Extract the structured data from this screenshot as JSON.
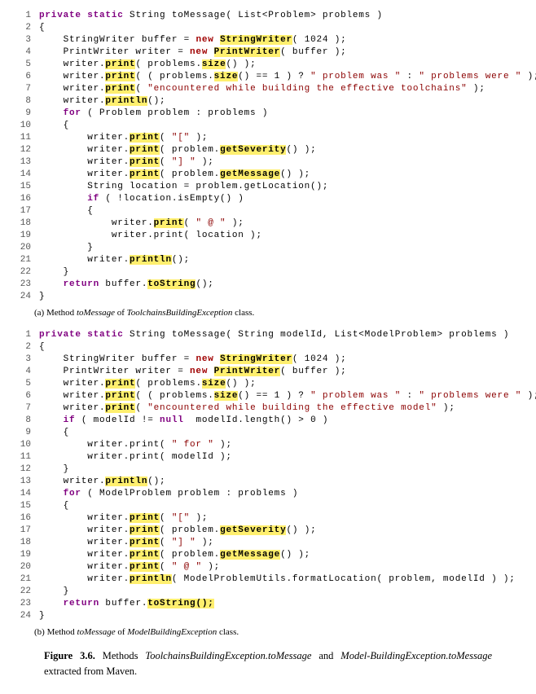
{
  "listingA": {
    "lines": [
      {
        "n": 1,
        "seg": [
          {
            "t": "private",
            "cls": "kw"
          },
          {
            "t": " "
          },
          {
            "t": "static",
            "cls": "kw"
          },
          {
            "t": " String toMessage( List<Problem> problems )"
          }
        ]
      },
      {
        "n": 2,
        "seg": [
          {
            "t": "{"
          }
        ]
      },
      {
        "n": 3,
        "seg": [
          {
            "t": "    StringWriter buffer = "
          },
          {
            "t": "new",
            "cls": "kwr"
          },
          {
            "t": " "
          },
          {
            "t": "StringWriter",
            "cls": "hl"
          },
          {
            "t": "( 1024 );"
          }
        ]
      },
      {
        "n": 4,
        "seg": [
          {
            "t": "    PrintWriter writer = "
          },
          {
            "t": "new",
            "cls": "kwr"
          },
          {
            "t": " "
          },
          {
            "t": "PrintWriter",
            "cls": "hl"
          },
          {
            "t": "( buffer );"
          }
        ]
      },
      {
        "n": 5,
        "seg": [
          {
            "t": "    writer."
          },
          {
            "t": "print",
            "cls": "hl"
          },
          {
            "t": "( problems."
          },
          {
            "t": "size",
            "cls": "hl"
          },
          {
            "t": "() );"
          }
        ]
      },
      {
        "n": 6,
        "seg": [
          {
            "t": "    writer."
          },
          {
            "t": "print",
            "cls": "hl"
          },
          {
            "t": "( ( problems."
          },
          {
            "t": "size",
            "cls": "hl"
          },
          {
            "t": "() == 1 ) ? "
          },
          {
            "t": "\" problem was \"",
            "cls": "str"
          },
          {
            "t": " : "
          },
          {
            "t": "\" problems were \"",
            "cls": "str"
          },
          {
            "t": " );"
          }
        ]
      },
      {
        "n": 7,
        "seg": [
          {
            "t": "    writer."
          },
          {
            "t": "print",
            "cls": "hl"
          },
          {
            "t": "( "
          },
          {
            "t": "\"encountered while building the effective toolchains\"",
            "cls": "str"
          },
          {
            "t": " );"
          }
        ]
      },
      {
        "n": 8,
        "seg": [
          {
            "t": "    writer."
          },
          {
            "t": "println",
            "cls": "hl"
          },
          {
            "t": "();"
          }
        ]
      },
      {
        "n": 9,
        "seg": [
          {
            "t": "    "
          },
          {
            "t": "for",
            "cls": "kw"
          },
          {
            "t": " ( Problem problem : problems )"
          }
        ]
      },
      {
        "n": 10,
        "seg": [
          {
            "t": "    {"
          }
        ]
      },
      {
        "n": 11,
        "seg": [
          {
            "t": "        writer."
          },
          {
            "t": "print",
            "cls": "hl"
          },
          {
            "t": "( "
          },
          {
            "t": "\"[\"",
            "cls": "str"
          },
          {
            "t": " );"
          }
        ]
      },
      {
        "n": 12,
        "seg": [
          {
            "t": "        writer."
          },
          {
            "t": "print",
            "cls": "hl"
          },
          {
            "t": "( problem."
          },
          {
            "t": "getSeverity",
            "cls": "hl"
          },
          {
            "t": "() );"
          }
        ]
      },
      {
        "n": 13,
        "seg": [
          {
            "t": "        writer."
          },
          {
            "t": "print",
            "cls": "hl"
          },
          {
            "t": "( "
          },
          {
            "t": "\"] \"",
            "cls": "str"
          },
          {
            "t": " );"
          }
        ]
      },
      {
        "n": 14,
        "seg": [
          {
            "t": "        writer."
          },
          {
            "t": "print",
            "cls": "hl"
          },
          {
            "t": "( problem."
          },
          {
            "t": "getMessage",
            "cls": "hl"
          },
          {
            "t": "() );"
          }
        ]
      },
      {
        "n": 15,
        "seg": [
          {
            "t": "        String location = problem.getLocation();"
          }
        ]
      },
      {
        "n": 16,
        "seg": [
          {
            "t": "        "
          },
          {
            "t": "if",
            "cls": "kw"
          },
          {
            "t": " ( !location.isEmpty() )"
          }
        ]
      },
      {
        "n": 17,
        "seg": [
          {
            "t": "        {"
          }
        ]
      },
      {
        "n": 18,
        "seg": [
          {
            "t": "            writer."
          },
          {
            "t": "print",
            "cls": "hl"
          },
          {
            "t": "( "
          },
          {
            "t": "\" @ \"",
            "cls": "str"
          },
          {
            "t": " );"
          }
        ]
      },
      {
        "n": 19,
        "seg": [
          {
            "t": "            writer.print( location );"
          }
        ]
      },
      {
        "n": 20,
        "seg": [
          {
            "t": "        }"
          }
        ]
      },
      {
        "n": 21,
        "seg": [
          {
            "t": "        writer."
          },
          {
            "t": "println",
            "cls": "hl"
          },
          {
            "t": "();"
          }
        ]
      },
      {
        "n": 22,
        "seg": [
          {
            "t": "    }"
          }
        ]
      },
      {
        "n": 23,
        "seg": [
          {
            "t": "    "
          },
          {
            "t": "return",
            "cls": "kw"
          },
          {
            "t": " buffer."
          },
          {
            "t": "toString",
            "cls": "hl"
          },
          {
            "t": "();"
          }
        ]
      },
      {
        "n": 24,
        "seg": [
          {
            "t": "}"
          }
        ]
      }
    ]
  },
  "captionA_prefix": "(a) Method ",
  "captionA_em1": "toMessage",
  "captionA_mid": " of ",
  "captionA_em2": "ToolchainsBuildingException",
  "captionA_suffix": " class.",
  "listingB": {
    "lines": [
      {
        "n": 1,
        "seg": [
          {
            "t": "private",
            "cls": "kw"
          },
          {
            "t": " "
          },
          {
            "t": "static",
            "cls": "kw"
          },
          {
            "t": " String toMessage( String modelId, List<ModelProblem> problems )"
          }
        ]
      },
      {
        "n": 2,
        "seg": [
          {
            "t": "{"
          }
        ]
      },
      {
        "n": 3,
        "seg": [
          {
            "t": "    StringWriter buffer = "
          },
          {
            "t": "new",
            "cls": "kwr"
          },
          {
            "t": " "
          },
          {
            "t": "StringWriter",
            "cls": "hl"
          },
          {
            "t": "( 1024 );"
          }
        ]
      },
      {
        "n": 4,
        "seg": [
          {
            "t": "    PrintWriter writer = "
          },
          {
            "t": "new",
            "cls": "kwr"
          },
          {
            "t": " "
          },
          {
            "t": "PrintWriter",
            "cls": "hl"
          },
          {
            "t": "( buffer );"
          }
        ]
      },
      {
        "n": 5,
        "seg": [
          {
            "t": "    writer."
          },
          {
            "t": "print",
            "cls": "hl"
          },
          {
            "t": "( problems."
          },
          {
            "t": "size",
            "cls": "hl"
          },
          {
            "t": "() );"
          }
        ]
      },
      {
        "n": 6,
        "seg": [
          {
            "t": "    writer."
          },
          {
            "t": "print",
            "cls": "hl"
          },
          {
            "t": "( ( problems."
          },
          {
            "t": "size",
            "cls": "hl"
          },
          {
            "t": "() == 1 ) ? "
          },
          {
            "t": "\" problem was \"",
            "cls": "str"
          },
          {
            "t": " : "
          },
          {
            "t": "\" problems were \"",
            "cls": "str"
          },
          {
            "t": " );"
          }
        ]
      },
      {
        "n": 7,
        "seg": [
          {
            "t": "    writer."
          },
          {
            "t": "print",
            "cls": "hl"
          },
          {
            "t": "( "
          },
          {
            "t": "\"encountered while building the effective model\"",
            "cls": "str"
          },
          {
            "t": " );"
          }
        ]
      },
      {
        "n": 8,
        "seg": [
          {
            "t": "    "
          },
          {
            "t": "if",
            "cls": "kw"
          },
          {
            "t": " ( modelId != "
          },
          {
            "t": "null",
            "cls": "kw"
          },
          {
            "t": "  modelId.length() > 0 )"
          }
        ]
      },
      {
        "n": 9,
        "seg": [
          {
            "t": "    {"
          }
        ]
      },
      {
        "n": 10,
        "seg": [
          {
            "t": "        writer.print( "
          },
          {
            "t": "\" for \"",
            "cls": "str"
          },
          {
            "t": " );"
          }
        ]
      },
      {
        "n": 11,
        "seg": [
          {
            "t": "        writer.print( modelId );"
          }
        ]
      },
      {
        "n": 12,
        "seg": [
          {
            "t": "    }"
          }
        ]
      },
      {
        "n": 13,
        "seg": [
          {
            "t": "    writer."
          },
          {
            "t": "println",
            "cls": "hl"
          },
          {
            "t": "();"
          }
        ]
      },
      {
        "n": 14,
        "seg": [
          {
            "t": "    "
          },
          {
            "t": "for",
            "cls": "kw"
          },
          {
            "t": " ( ModelProblem problem : problems )"
          }
        ]
      },
      {
        "n": 15,
        "seg": [
          {
            "t": "    {"
          }
        ]
      },
      {
        "n": 16,
        "seg": [
          {
            "t": "        writer."
          },
          {
            "t": "print",
            "cls": "hl"
          },
          {
            "t": "( "
          },
          {
            "t": "\"[\"",
            "cls": "str"
          },
          {
            "t": " );"
          }
        ]
      },
      {
        "n": 17,
        "seg": [
          {
            "t": "        writer."
          },
          {
            "t": "print",
            "cls": "hl"
          },
          {
            "t": "( problem."
          },
          {
            "t": "getSeverity",
            "cls": "hl"
          },
          {
            "t": "() );"
          }
        ]
      },
      {
        "n": 18,
        "seg": [
          {
            "t": "        writer."
          },
          {
            "t": "print",
            "cls": "hl"
          },
          {
            "t": "( "
          },
          {
            "t": "\"] \"",
            "cls": "str"
          },
          {
            "t": " );"
          }
        ]
      },
      {
        "n": 19,
        "seg": [
          {
            "t": "        writer."
          },
          {
            "t": "print",
            "cls": "hl"
          },
          {
            "t": "( problem."
          },
          {
            "t": "getMessage",
            "cls": "hl"
          },
          {
            "t": "() );"
          }
        ]
      },
      {
        "n": 20,
        "seg": [
          {
            "t": "        writer."
          },
          {
            "t": "print",
            "cls": "hl"
          },
          {
            "t": "( "
          },
          {
            "t": "\" @ \"",
            "cls": "str"
          },
          {
            "t": " );"
          }
        ]
      },
      {
        "n": 21,
        "seg": [
          {
            "t": "        writer."
          },
          {
            "t": "println",
            "cls": "hl"
          },
          {
            "t": "( ModelProblemUtils.formatLocation( problem, modelId ) );"
          }
        ]
      },
      {
        "n": 22,
        "seg": [
          {
            "t": "    }"
          }
        ]
      },
      {
        "n": 23,
        "seg": [
          {
            "t": "    "
          },
          {
            "t": "return",
            "cls": "kw"
          },
          {
            "t": " buffer."
          },
          {
            "t": "toString();",
            "cls": "hl"
          }
        ]
      },
      {
        "n": 24,
        "seg": [
          {
            "t": "}"
          }
        ]
      }
    ]
  },
  "captionB_prefix": "(b) Method ",
  "captionB_em1": "toMessage",
  "captionB_mid": " of ",
  "captionB_em2": "ModelBuildingException",
  "captionB_suffix": " class.",
  "figcaption_label": "Figure 3.6.",
  "figcaption_sep": "    ",
  "figcaption_pre": "Methods ",
  "figcaption_em1": "ToolchainsBuildingException.toMessage",
  "figcaption_and": " and ",
  "figcaption_em2": "Model-BuildingException.toMessage",
  "figcaption_post": " extracted from Maven."
}
